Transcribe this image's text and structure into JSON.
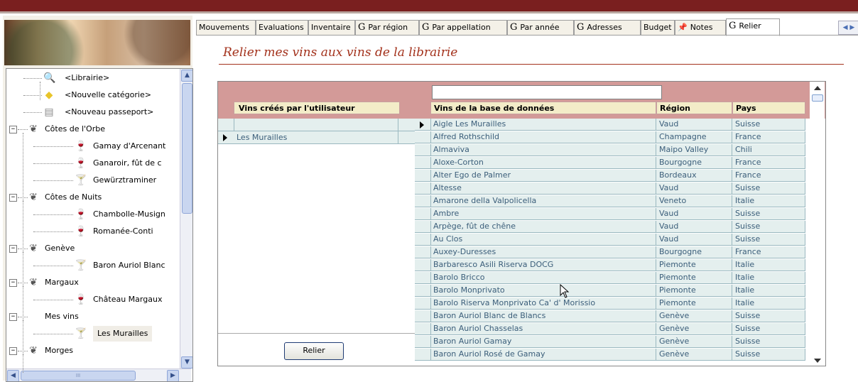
{
  "tabs": [
    {
      "label": "Mouvements",
      "g": false
    },
    {
      "label": "Evaluations",
      "g": false
    },
    {
      "label": "Inventaire",
      "g": false
    },
    {
      "label": "Par région",
      "g": true
    },
    {
      "label": "Par appellation",
      "g": true
    },
    {
      "label": "Par année",
      "g": true
    },
    {
      "label": "Adresses",
      "g": true
    },
    {
      "label": "Budget",
      "g": false
    },
    {
      "label": "Notes",
      "g": false,
      "icon": "pushpin-icon"
    },
    {
      "label": "Relier",
      "g": true,
      "active": true
    }
  ],
  "tab_g_glyph": "G",
  "page_title": "Relier mes vins aux vins de la librairie",
  "tree": {
    "items": [
      {
        "label": "<Librairie>",
        "icon": "library-icon"
      },
      {
        "label": "<Nouvelle catégorie>",
        "icon": "folder-icon"
      },
      {
        "label": "<Nouveau passeport>",
        "icon": "passport-icon"
      },
      {
        "label": "Côtes de l'Orbe",
        "icon": "vineyard-icon",
        "toggle": "−"
      },
      {
        "label": "Gamay d'Arcenant",
        "icon": "wine-glass-red-icon"
      },
      {
        "label": "Ganaroir, fût de c",
        "icon": "wine-glass-red-icon"
      },
      {
        "label": "Gewürztraminer",
        "icon": "wine-glass-white-icon"
      },
      {
        "label": "Côtes de Nuits",
        "icon": "vineyard-icon",
        "toggle": "−"
      },
      {
        "label": "Chambolle-Musign",
        "icon": "wine-glass-red-icon"
      },
      {
        "label": "Romanée-Conti",
        "icon": "wine-glass-red-icon"
      },
      {
        "label": "Genève",
        "icon": "vineyard-icon",
        "toggle": "−"
      },
      {
        "label": "Baron Auriol Blanc",
        "icon": "wine-glass-white-icon"
      },
      {
        "label": "Margaux",
        "icon": "vineyard-icon",
        "toggle": "−"
      },
      {
        "label": "Château Margaux",
        "icon": "wine-glass-red-icon"
      },
      {
        "label": "Mes vins",
        "icon": "",
        "toggle": "−"
      },
      {
        "label": "Les Murailles",
        "icon": "wine-glass-white-icon",
        "selected": true
      },
      {
        "label": "Morges",
        "icon": "vineyard-icon",
        "toggle": "−"
      }
    ]
  },
  "user_wines": {
    "header": "Vins créés par l'utilisateur",
    "rows": [
      "",
      "Les Murailles"
    ],
    "button": "Relier"
  },
  "db_wines": {
    "search_value": "",
    "headers": {
      "name": "Vins de la base de données",
      "region": "Région",
      "country": "Pays"
    },
    "rows": [
      [
        "Aigle Les Murailles",
        "Vaud",
        "Suisse"
      ],
      [
        "Alfred Rothschild",
        "Champagne",
        "France"
      ],
      [
        "Almaviva",
        "Maipo Valley",
        "Chili"
      ],
      [
        "Aloxe-Corton",
        "Bourgogne",
        "France"
      ],
      [
        "Alter Ego de Palmer",
        "Bordeaux",
        "France"
      ],
      [
        "Altesse",
        "Vaud",
        "Suisse"
      ],
      [
        "Amarone della Valpolicella",
        "Veneto",
        "Italie"
      ],
      [
        "Ambre",
        "Vaud",
        "Suisse"
      ],
      [
        "Arpège, fût de chêne",
        "Vaud",
        "Suisse"
      ],
      [
        "Au Clos",
        "Vaud",
        "Suisse"
      ],
      [
        "Auxey-Duresses",
        "Bourgogne",
        "France"
      ],
      [
        "Barbaresco Asili Riserva DOCG",
        "Piemonte",
        "Italie"
      ],
      [
        "Barolo Bricco",
        "Piemonte",
        "Italie"
      ],
      [
        "Barolo Monprivato",
        "Piemonte",
        "Italie"
      ],
      [
        "Barolo Riserva Monprivato Ca' d' Morissio",
        "Piemonte",
        "Italie"
      ],
      [
        "Baron Auriol Blanc de Blancs",
        "Genève",
        "Suisse"
      ],
      [
        "Baron Auriol Chasselas",
        "Genève",
        "Suisse"
      ],
      [
        "Baron Auriol Gamay",
        "Genève",
        "Suisse"
      ],
      [
        "Baron Auriol Rosé de Gamay",
        "Genève",
        "Suisse"
      ]
    ]
  },
  "colors": {
    "title": "#a3321c",
    "header_band": "#d39a98",
    "row_bg": "#e4efee",
    "row_text": "#3b5e7a"
  }
}
